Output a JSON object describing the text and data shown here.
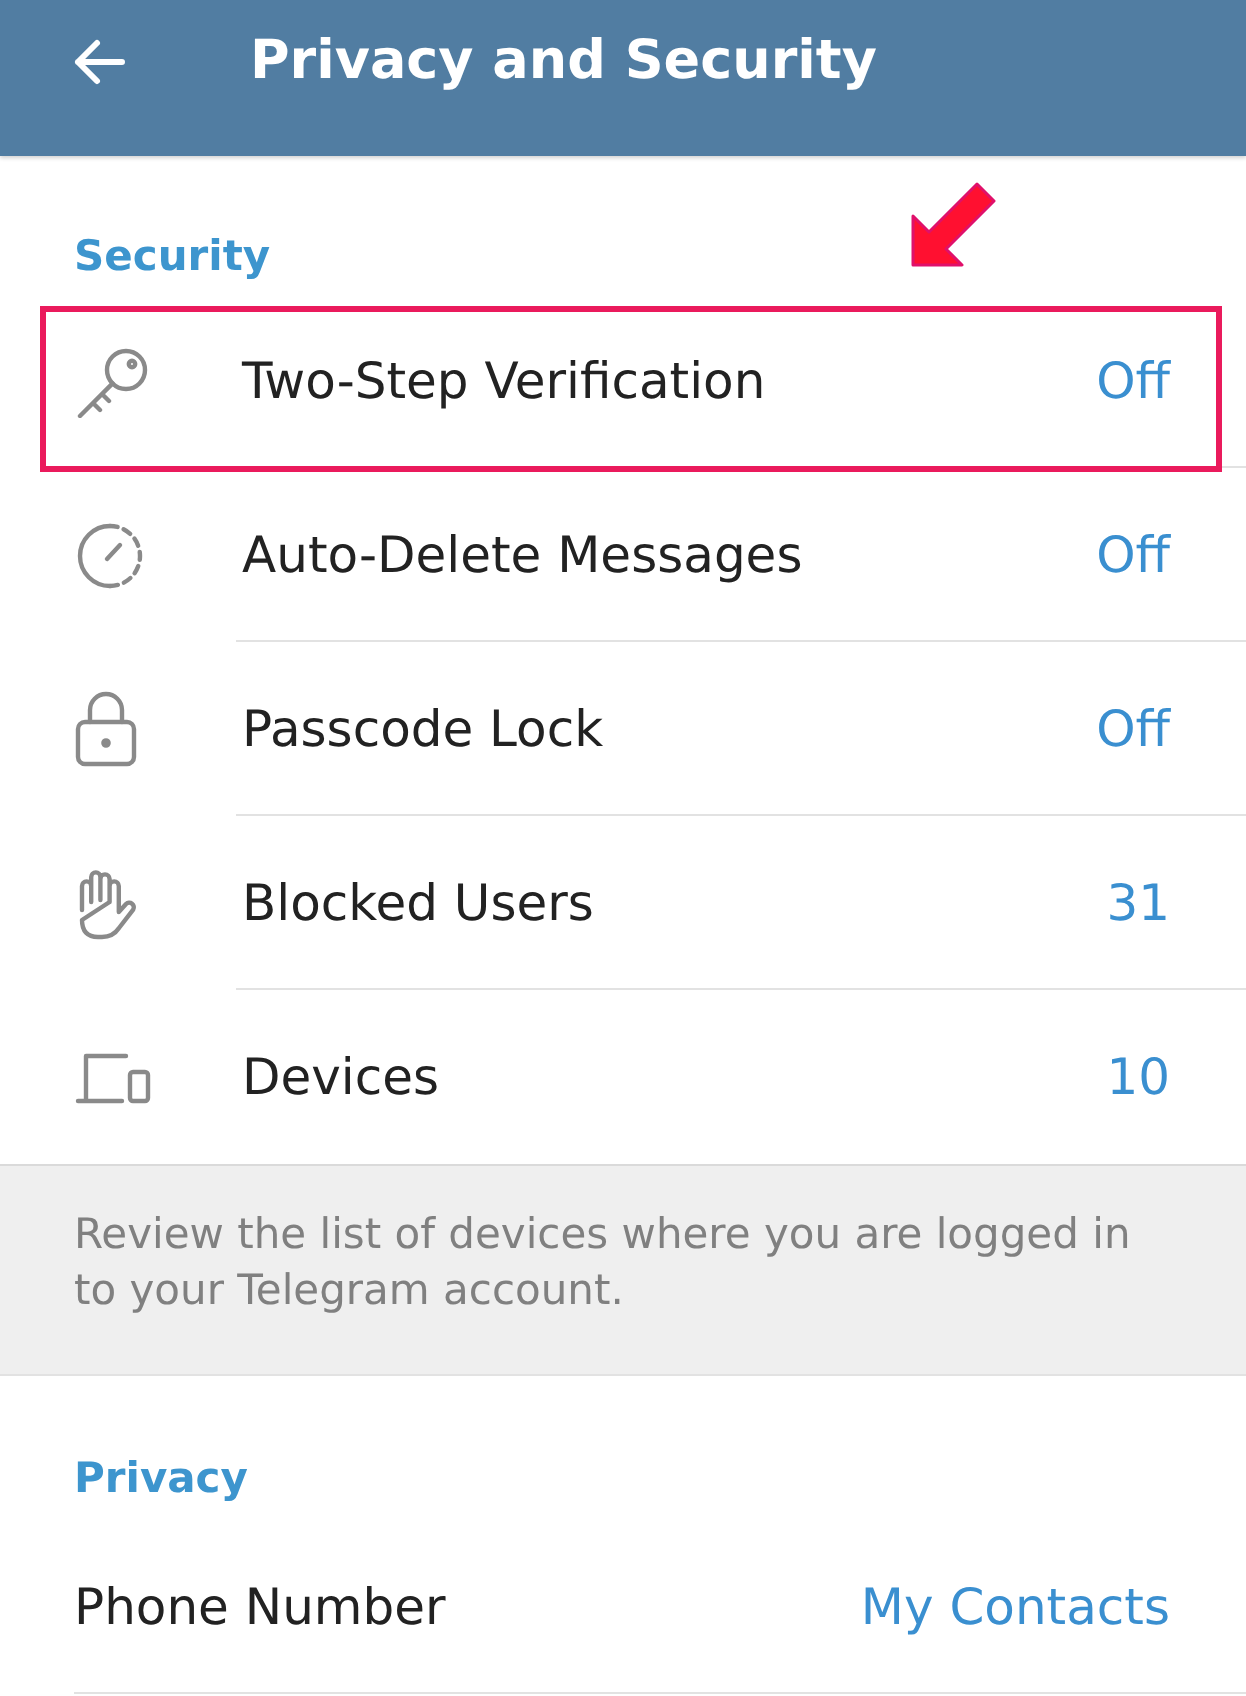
{
  "app_bar": {
    "title": "Privacy and Security"
  },
  "sections": [
    {
      "title": "Security",
      "items": [
        {
          "kind": "icon",
          "label": "Two-Step Verification",
          "value": "Off",
          "highlighted": true
        },
        {
          "kind": "icon",
          "label": "Auto-Delete Messages",
          "value": "Off",
          "highlighted": false
        },
        {
          "kind": "icon",
          "label": "Passcode Lock",
          "value": "Off",
          "highlighted": false
        },
        {
          "kind": "icon",
          "label": "Blocked Users",
          "value": "31",
          "highlighted": false
        },
        {
          "kind": "icon",
          "label": "Devices",
          "value": "10",
          "highlighted": false
        }
      ],
      "footer": "Review the list of devices where you are logged in to your Telegram account."
    },
    {
      "title": "Privacy",
      "items": [
        {
          "kind": "plain",
          "label": "Phone Number",
          "value": "My Contacts",
          "highlighted": false
        }
      ]
    }
  ]
}
